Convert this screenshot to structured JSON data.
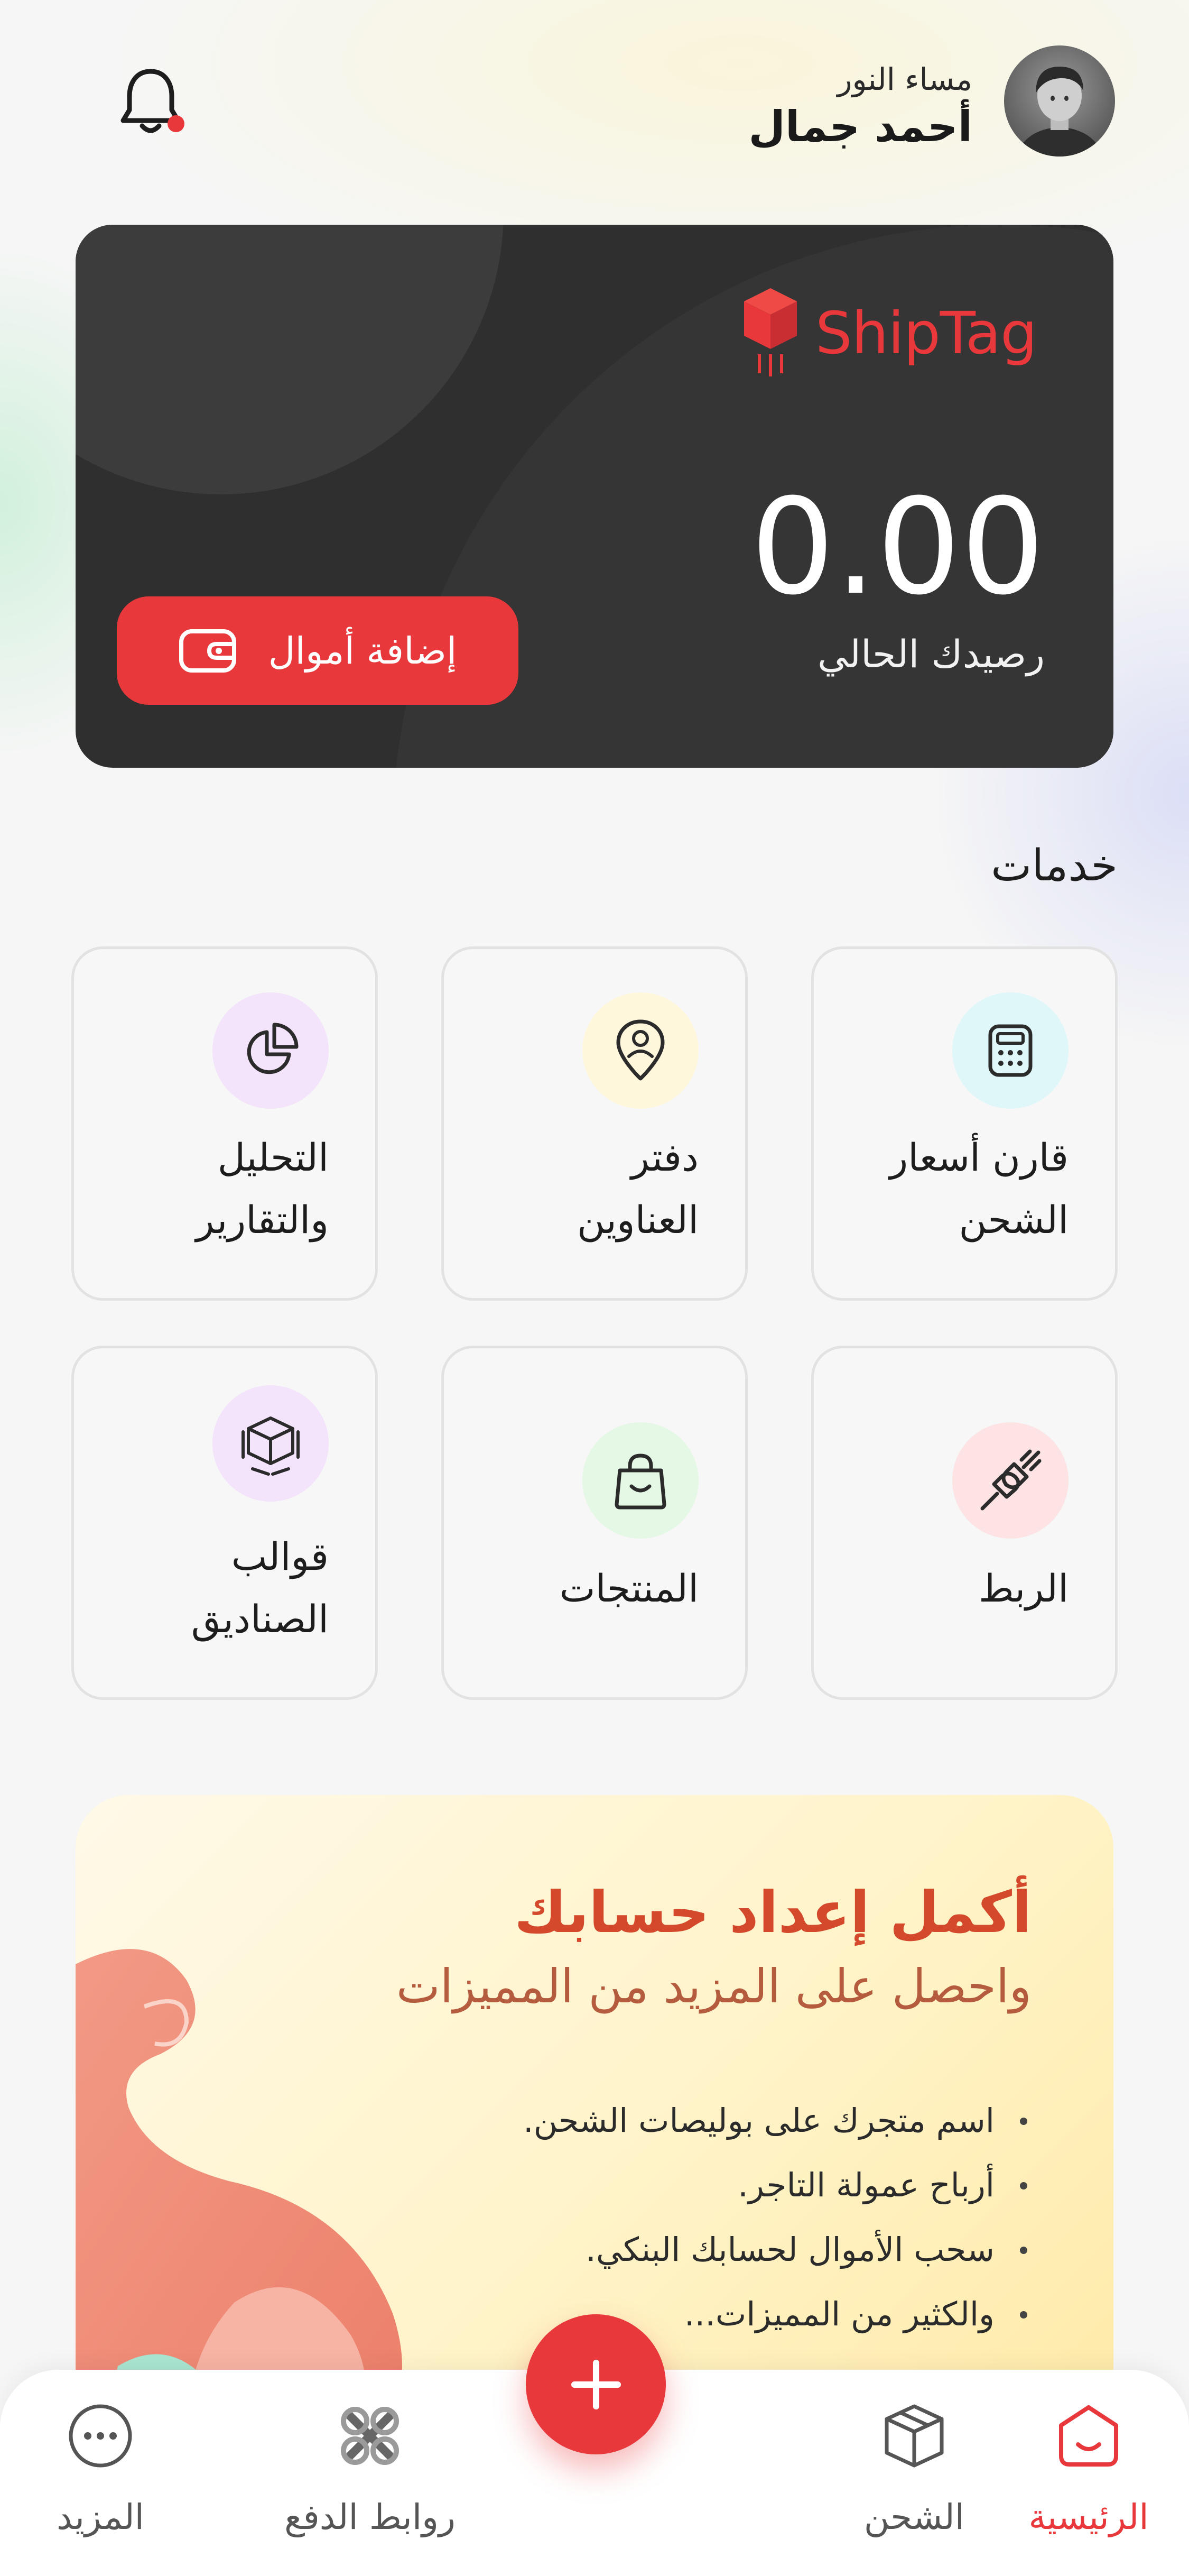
{
  "header": {
    "greeting": "مساء النور",
    "user_name": "أحمد جمال"
  },
  "balance_card": {
    "brand": "ShipTag",
    "balance": "0.00",
    "balance_label": "رصيدك الحالي",
    "add_funds_label": "إضافة أموال"
  },
  "services": {
    "title": "خدمات",
    "items": [
      {
        "label_line1": "قارن أسعار",
        "label_line2": "الشحن",
        "icon": "calculator-icon",
        "icon_bg": "#dff7f9"
      },
      {
        "label_line1": "دفتر",
        "label_line2": "العناوين",
        "icon": "location-pin-icon",
        "icon_bg": "#fff7dc"
      },
      {
        "label_line1": "التحليل",
        "label_line2": "والتقارير",
        "icon": "pie-chart-icon",
        "icon_bg": "#f3e3fb"
      },
      {
        "label_line1": "الربط",
        "label_line2": "",
        "icon": "plug-icon",
        "icon_bg": "#fde3e3"
      },
      {
        "label_line1": "المنتجات",
        "label_line2": "",
        "icon": "shopping-bag-icon",
        "icon_bg": "#e5f8e5"
      },
      {
        "label_line1": "قوالب",
        "label_line2": "الصناديق",
        "icon": "box-dimensions-icon",
        "icon_bg": "#f3e3fb"
      }
    ]
  },
  "promo": {
    "title": "أكمل إعداد حسابك",
    "subtitle": "واحصل على المزيد من المميزات",
    "bullets": [
      "اسم متجرك على بوليصات الشحن.",
      "أرباح عمولة التاجر.",
      "سحب الأموال لحسابك البنكي.",
      "والكثير من المميزات..."
    ]
  },
  "bottom_nav": {
    "items": [
      {
        "label": "الرئيسية",
        "icon": "home-icon",
        "active": true
      },
      {
        "label": "الشحن",
        "icon": "package-icon",
        "active": false
      },
      {
        "label": "روابط الدفع",
        "icon": "payment-links-icon",
        "active": false
      },
      {
        "label": "المزيد",
        "icon": "more-icon",
        "active": false
      }
    ],
    "fab_icon": "plus-icon"
  },
  "colors": {
    "accent": "#e8383b",
    "card_bg": "#2f2f2f",
    "promo_title": "#d4492b"
  }
}
